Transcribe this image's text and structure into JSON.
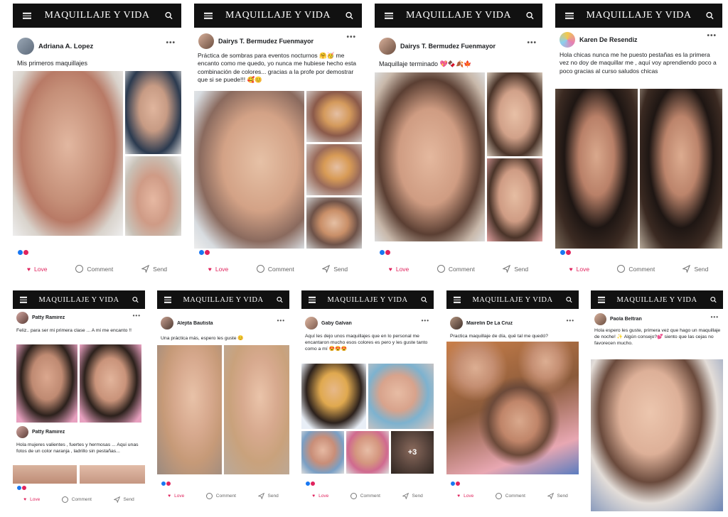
{
  "app": {
    "brand": "MAQUILLAJE Y VIDA"
  },
  "actions": {
    "love": "Love",
    "comment": "Comment",
    "send": "Send"
  },
  "icons": {
    "menu": "menu-icon",
    "search": "search-icon",
    "more": "more-dots-icon",
    "love": "heart-icon",
    "comment": "comment-bubble-icon",
    "send": "send-icon"
  },
  "colors": {
    "topbar": "#111111",
    "love": "#e0245e",
    "like": "#1877f2"
  },
  "posts": [
    {
      "user": "Adriana A. Lopez",
      "text": "Mis primeros maquillajes"
    },
    {
      "user": "Dairys T. Bermudez Fuenmayor",
      "text": "Práctica de sombras para eventos nocturnos 🤗🥳 me encanto como me quedo, yo nunca me hubiese hecho esta combinación de colores... gracias a la profe por demostrar que si se puede!!! 🥰😊"
    },
    {
      "user": "Dairys T. Bermudez Fuenmayor",
      "text": "Maquillaje terminado 💖🍫🍂🍁"
    },
    {
      "user": "Karen De Resendiz",
      "text": "Hola chicas nunca me he puesto pestañas es la primera vez no doy de maquillar me , aquí voy aprendiendo poco a poco gracias al curso saludos chicas"
    },
    {
      "user": "Patty  Ramirez",
      "text": "Feliz.. para ser mi primera clase ... A mi me encanto !!",
      "user2": "Patty  Ramirez",
      "text2": "Hola mujeres valientes , fuertes y hermosas ... Aqui unas fotos de un color naranja , ladrillo sin pestañas..."
    },
    {
      "user": "Alejita Bautista",
      "text": "Una práctica más, espero les guste 😊"
    },
    {
      "user": "Gaby Galvan",
      "text": "Aquí les dejo unos maquillajes que en lo personal me encantaron mucho esos colores es pero y les guste tanto como a mí 😍😍😍",
      "more_count": "+3"
    },
    {
      "user": "Mairelin De La Cruz",
      "text": "Practica maquillaje de día, qué tal me quedó?"
    },
    {
      "user": "Paola Beltran",
      "text": "Hola espero les guste, primera vez que hago un maquillaje de noche! ✨ Algún consejo?💕 siento que las cejas no favorecen mucho."
    }
  ]
}
